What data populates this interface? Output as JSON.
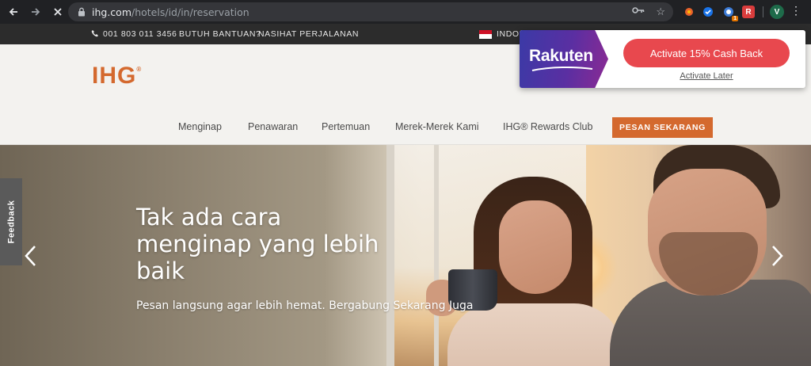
{
  "browser": {
    "url_host": "ihg.com",
    "url_path": "/hotels/id/in/reservation",
    "extension_badge": "1",
    "profile_initial": "V"
  },
  "utility_bar": {
    "phone": "001 803 011 3456",
    "help": "BUTUH BANTUAN?",
    "advice": "NASIHAT PERJALANAN",
    "language": "INDON"
  },
  "header": {
    "logo": "IHG",
    "logo_mark": "®",
    "nav": [
      {
        "label": "Menginap"
      },
      {
        "label": "Penawaran"
      },
      {
        "label": "Pertemuan"
      },
      {
        "label": "Merek-Merek Kami"
      },
      {
        "label": "IHG® Rewards Club"
      }
    ],
    "book_button": "PESAN SEKARANG"
  },
  "hero": {
    "title": "Tak ada cara menginap yang lebih baik",
    "subtitle": "Pesan langsung agar lebih hemat. Bergabung Sekarang Juga"
  },
  "feedback_tab": "Feedback",
  "rakuten": {
    "brand": "Rakuten",
    "cta": "Activate 15% Cash Back",
    "later": "Activate Later",
    "colors": {
      "cta": "#e8484e",
      "brand_from": "#3b3aa6",
      "brand_to": "#8b2a93"
    }
  },
  "colors": {
    "ihg_orange": "#d4692e",
    "util_bar": "#2c2c2c",
    "chrome": "#202124"
  }
}
